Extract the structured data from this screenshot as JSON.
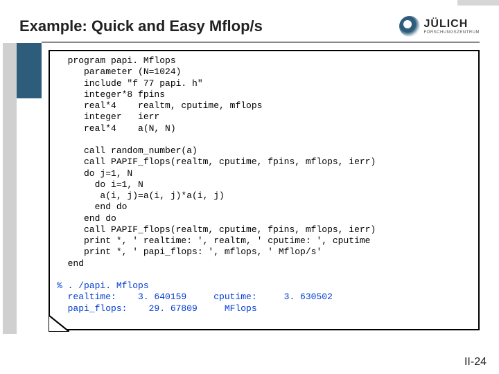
{
  "header": {
    "title": "Example: Quick and Easy Mflop/s",
    "logo_main": "JÜLICH",
    "logo_sub": "FORSCHUNGSZENTRUM"
  },
  "panel": {
    "code_lines": [
      "  program papi. Mflops",
      "     parameter (N=1024)",
      "     include \"f 77 papi. h\"",
      "     integer*8 fpins",
      "     real*4    realtm, cputime, mflops",
      "     integer   ierr",
      "     real*4    a(N, N)",
      "",
      "     call random_number(a)",
      "     call PAPIF_flops(realtm, cputime, fpins, mflops, ierr)",
      "     do j=1, N",
      "       do i=1, N",
      "        a(i, j)=a(i, j)*a(i, j)",
      "       end do",
      "     end do",
      "     call PAPIF_flops(realtm, cputime, fpins, mflops, ierr)",
      "     print *, ' realtime: ', realtm, ' cputime: ', cputime",
      "     print *, ' papi_flops: ', mflops, ' Mflop/s'",
      "  end"
    ],
    "output_lines": [
      "% . /papi. Mflops",
      "  realtime:    3. 640159     cputime:     3. 630502",
      "  papi_flops:    29. 67809     MFlops"
    ]
  },
  "pagenum": "II-24"
}
